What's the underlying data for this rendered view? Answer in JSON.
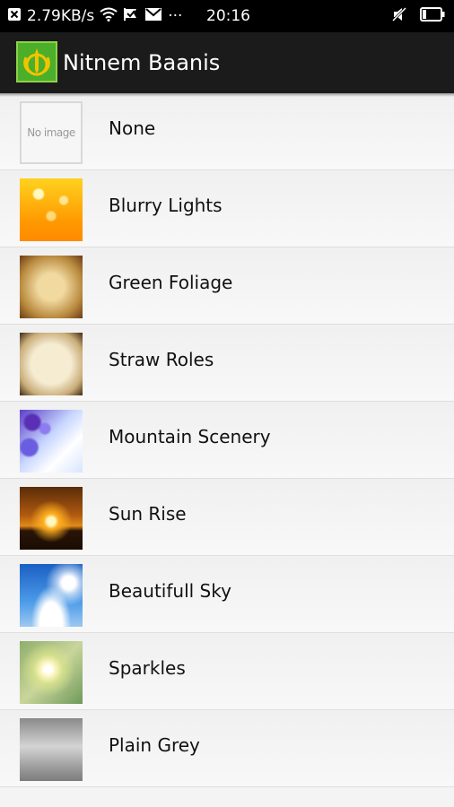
{
  "status_bar": {
    "speed": "2.79KB/s",
    "more": "···",
    "time": "20:16",
    "icons": [
      "notification-x-icon",
      "wifi-icon",
      "check-flag-icon",
      "mail-icon",
      "mute-icon",
      "battery-icon"
    ]
  },
  "app_bar": {
    "title": "Nitnem Baanis",
    "logo_icon": "khanda-logo-icon",
    "background": "#1b1b1b"
  },
  "backgrounds": {
    "items": [
      {
        "label": "None",
        "thumb_text": "No image",
        "icon": "no-image-icon"
      },
      {
        "label": "Blurry Lights",
        "icon": "blurry-lights-thumbnail"
      },
      {
        "label": "Green Foliage",
        "icon": "green-foliage-thumbnail"
      },
      {
        "label": "Straw Roles",
        "icon": "straw-roles-thumbnail"
      },
      {
        "label": "Mountain Scenery",
        "icon": "mountain-scenery-thumbnail"
      },
      {
        "label": "Sun Rise",
        "icon": "sun-rise-thumbnail"
      },
      {
        "label": "Beautifull Sky",
        "icon": "beautifull-sky-thumbnail"
      },
      {
        "label": "Sparkles",
        "icon": "sparkles-thumbnail"
      },
      {
        "label": "Plain Grey",
        "icon": "plain-grey-thumbnail"
      }
    ]
  }
}
